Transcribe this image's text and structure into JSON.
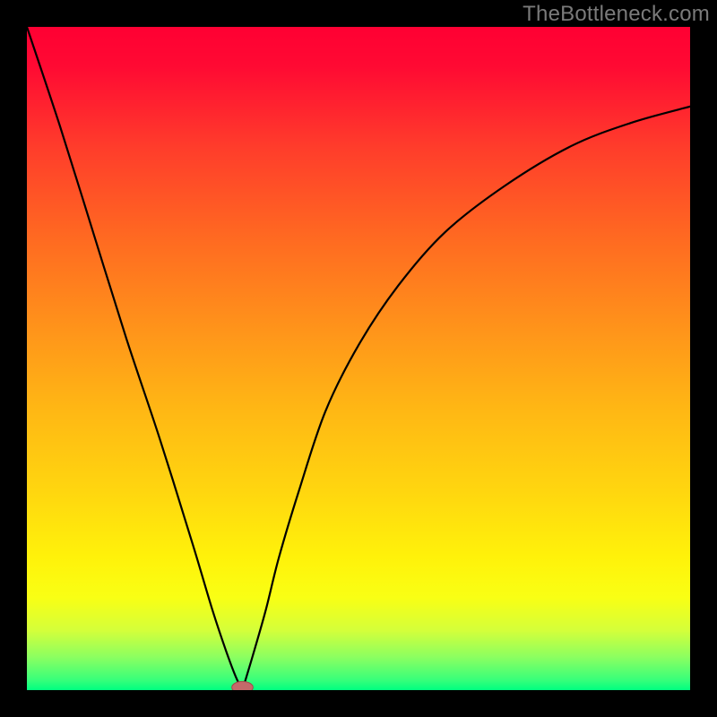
{
  "watermark": "TheBottleneck.com",
  "colors": {
    "frame": "#000000",
    "gradient_stops": [
      {
        "offset": 0.0,
        "color": "#ff0033"
      },
      {
        "offset": 0.06,
        "color": "#ff0a33"
      },
      {
        "offset": 0.18,
        "color": "#ff3c2b"
      },
      {
        "offset": 0.32,
        "color": "#ff6a21"
      },
      {
        "offset": 0.46,
        "color": "#ff951a"
      },
      {
        "offset": 0.58,
        "color": "#ffb814"
      },
      {
        "offset": 0.7,
        "color": "#ffd60f"
      },
      {
        "offset": 0.8,
        "color": "#fff20a"
      },
      {
        "offset": 0.86,
        "color": "#f9ff14"
      },
      {
        "offset": 0.91,
        "color": "#d4ff3a"
      },
      {
        "offset": 0.95,
        "color": "#8cff60"
      },
      {
        "offset": 0.985,
        "color": "#37ff7a"
      },
      {
        "offset": 1.0,
        "color": "#00ff80"
      }
    ],
    "curve": "#000000",
    "marker_fill": "#c46a6a",
    "marker_stroke": "#a24a4a"
  },
  "chart_data": {
    "type": "line",
    "title": "",
    "xlabel": "",
    "ylabel": "",
    "xlim": [
      0,
      100
    ],
    "ylim": [
      0,
      100
    ],
    "grid": false,
    "axes_visible": false,
    "series": [
      {
        "name": "curve",
        "segment": "left",
        "description": "Steep nearly-linear descending branch entering from top-left edge down to the minimum.",
        "x": [
          0,
          5,
          10,
          15,
          20,
          25,
          28,
          30,
          31.5,
          32.5
        ],
        "y": [
          100,
          85,
          69,
          53,
          38,
          22,
          12,
          6,
          2,
          0
        ]
      },
      {
        "name": "curve",
        "segment": "right",
        "description": "Convex rising branch from minimum, decelerating toward upper-right, exiting mid-right edge.",
        "x": [
          32.5,
          34,
          36,
          38,
          41,
          45,
          50,
          56,
          63,
          72,
          82,
          91,
          100
        ],
        "y": [
          0,
          5,
          12,
          20,
          30,
          42,
          52,
          61,
          69,
          76,
          82,
          85.5,
          88
        ]
      }
    ],
    "annotations": [
      {
        "name": "minimum-marker",
        "shape": "ellipse",
        "x": 32.5,
        "y": 0,
        "rx": 1.6,
        "ry": 0.9
      }
    ]
  }
}
